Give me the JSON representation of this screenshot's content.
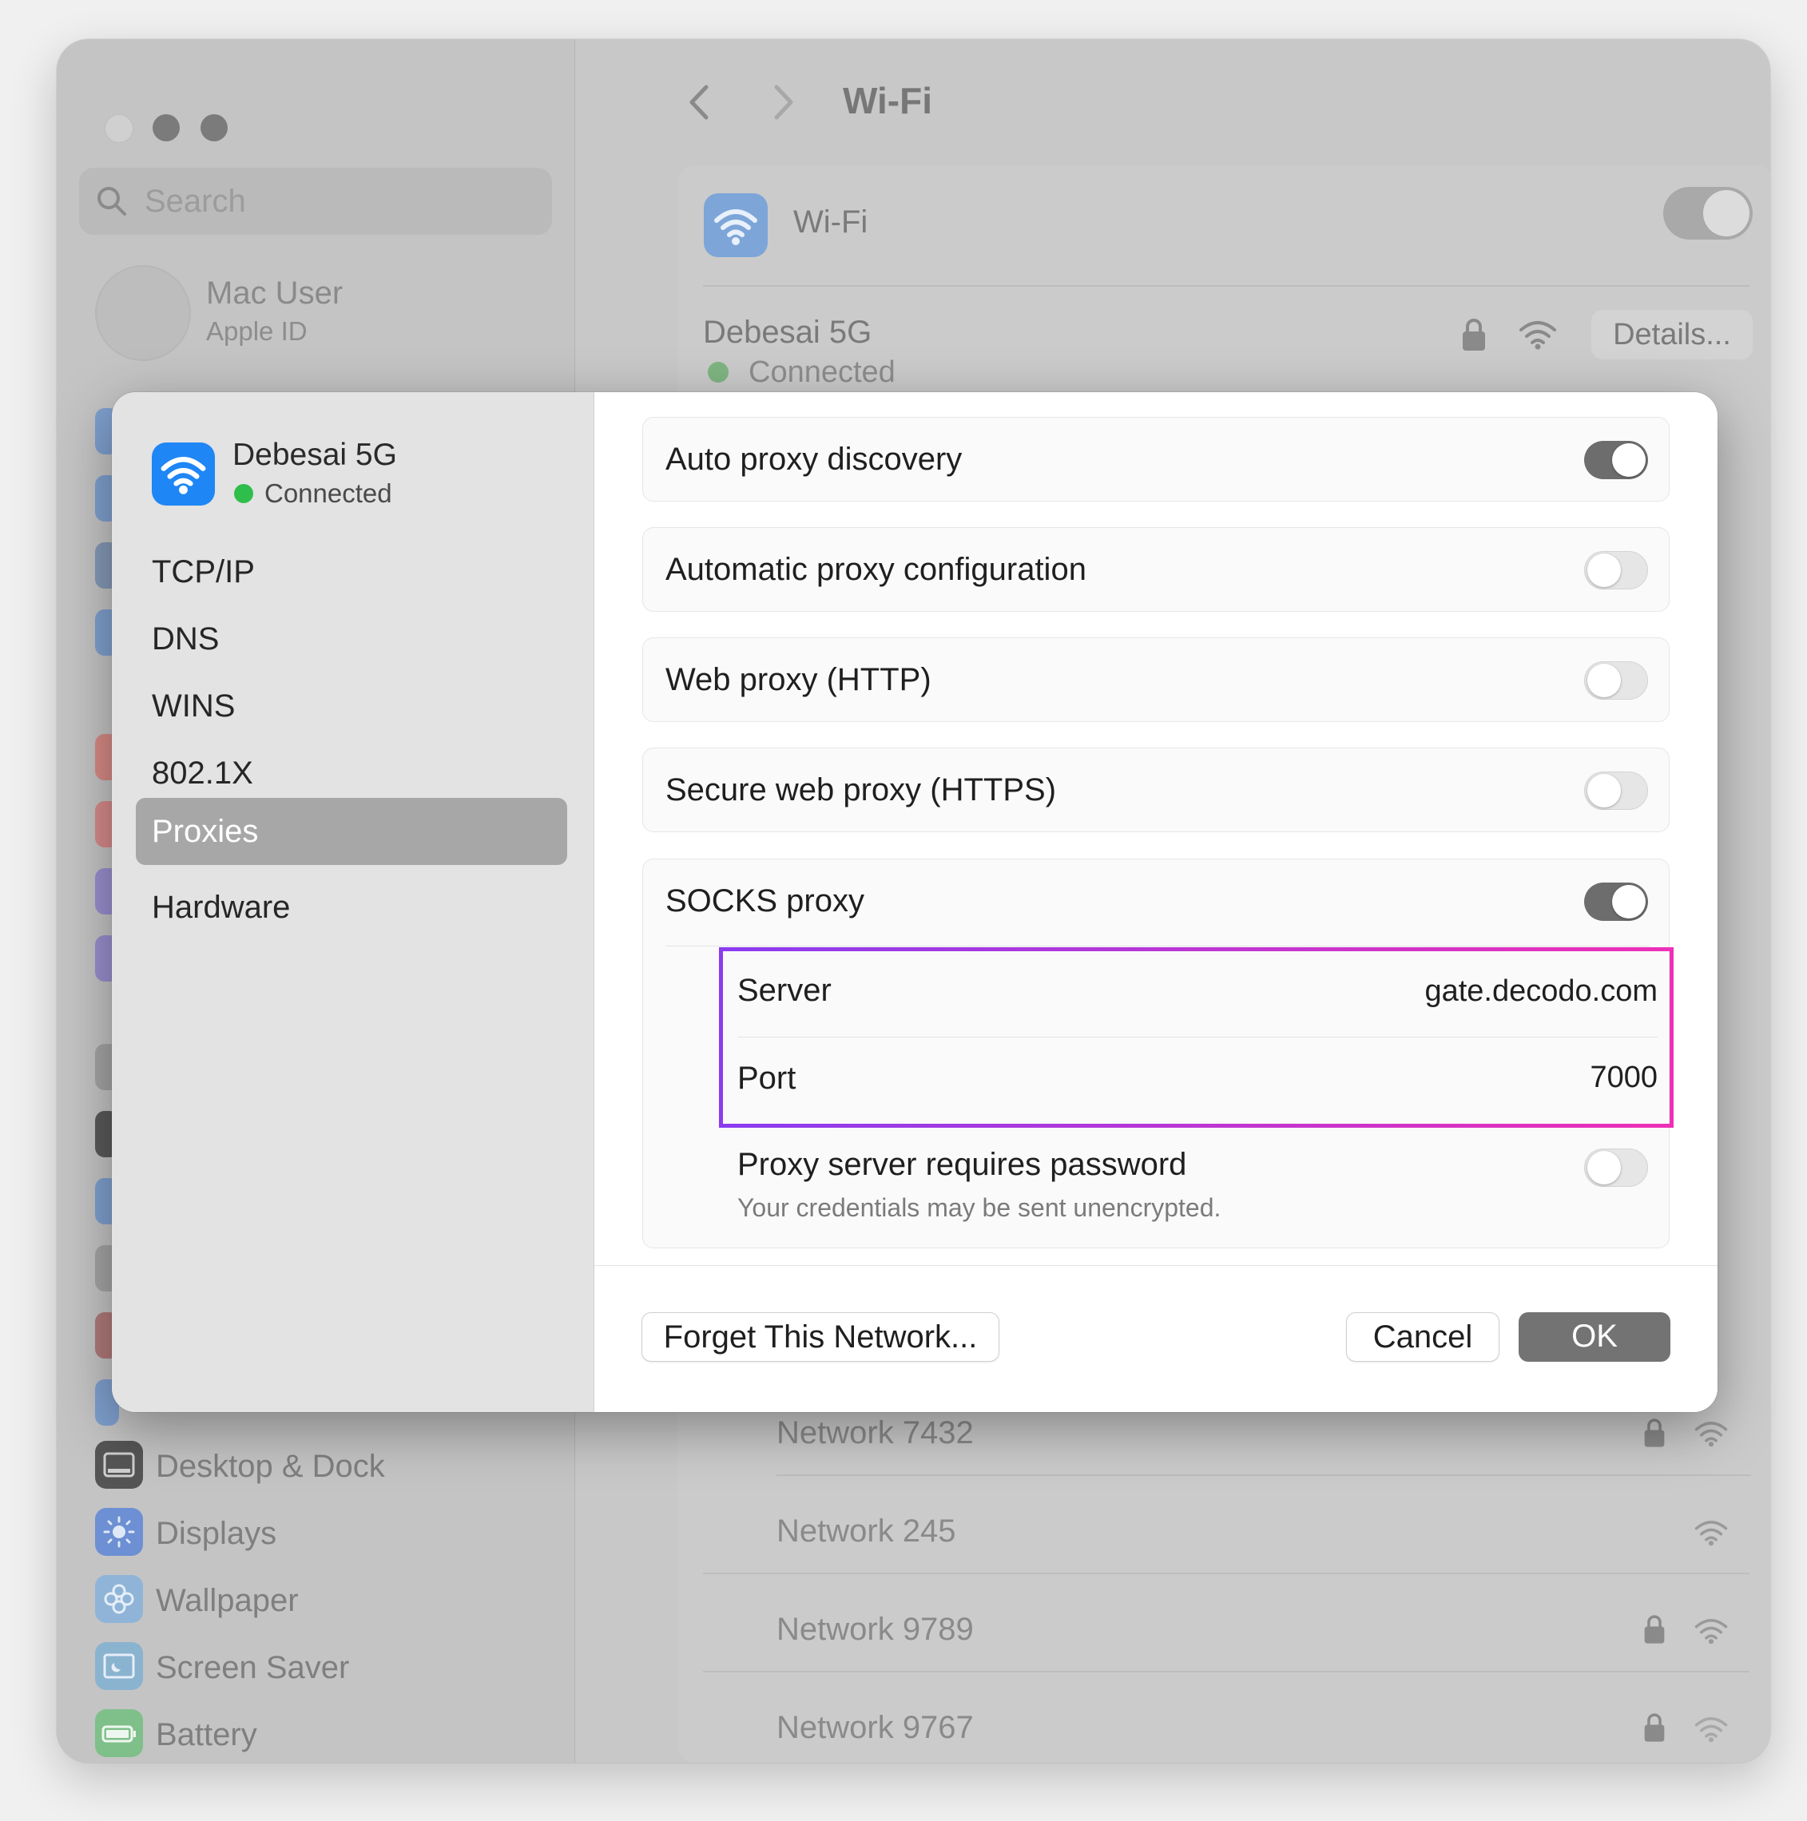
{
  "window": {
    "title": "Wi-Fi",
    "search": {
      "placeholder": "Search"
    },
    "user": {
      "name": "Mac User",
      "subtitle": "Apple ID"
    },
    "sidebar_items": [
      {
        "label": "Desktop & Dock",
        "icon": "desktop-dock-icon",
        "color": "#4a4a4a"
      },
      {
        "label": "Displays",
        "icon": "displays-icon",
        "color": "#6d8fd3"
      },
      {
        "label": "Wallpaper",
        "icon": "wallpaper-icon",
        "color": "#8fb4d8"
      },
      {
        "label": "Screen Saver",
        "icon": "screen-saver-icon",
        "color": "#8ab3cf"
      },
      {
        "label": "Battery",
        "icon": "battery-icon",
        "color": "#7fc08a"
      }
    ],
    "wifi_section": {
      "label": "Wi-Fi",
      "enabled": true,
      "current_network": {
        "name": "Debesai 5G",
        "status": "Connected",
        "details_label": "Details..."
      }
    },
    "other_networks": [
      {
        "name": "Network 7432",
        "locked": true
      },
      {
        "name": "Network 245",
        "locked": false
      },
      {
        "name": "Network 9789",
        "locked": true
      },
      {
        "name": "Network 9767",
        "locked": true
      }
    ]
  },
  "dialog": {
    "network": {
      "name": "Debesai 5G",
      "status": "Connected"
    },
    "tabs": [
      {
        "label": "TCP/IP"
      },
      {
        "label": "DNS"
      },
      {
        "label": "WINS"
      },
      {
        "label": "802.1X"
      },
      {
        "label": "Proxies",
        "selected": true
      },
      {
        "label": "Hardware"
      }
    ],
    "proxies": [
      {
        "label": "Auto proxy discovery",
        "enabled": true
      },
      {
        "label": "Automatic proxy configuration",
        "enabled": false
      },
      {
        "label": "Web proxy (HTTP)",
        "enabled": false
      },
      {
        "label": "Secure web proxy (HTTPS)",
        "enabled": false
      }
    ],
    "socks": {
      "label": "SOCKS proxy",
      "enabled": true,
      "server_label": "Server",
      "server_value": "gate.decodo.com",
      "port_label": "Port",
      "port_value": "7000",
      "password_label": "Proxy server requires password",
      "password_note": "Your credentials may be sent unencrypted.",
      "password_enabled": false
    },
    "buttons": {
      "forget": "Forget This Network...",
      "cancel": "Cancel",
      "ok": "OK"
    }
  },
  "colors": {
    "accent_blue": "#1f86f5",
    "connected_green": "#2fbe4b",
    "highlight_gradient_start": "#8a3cf0",
    "highlight_gradient_end": "#ee2fb7"
  }
}
